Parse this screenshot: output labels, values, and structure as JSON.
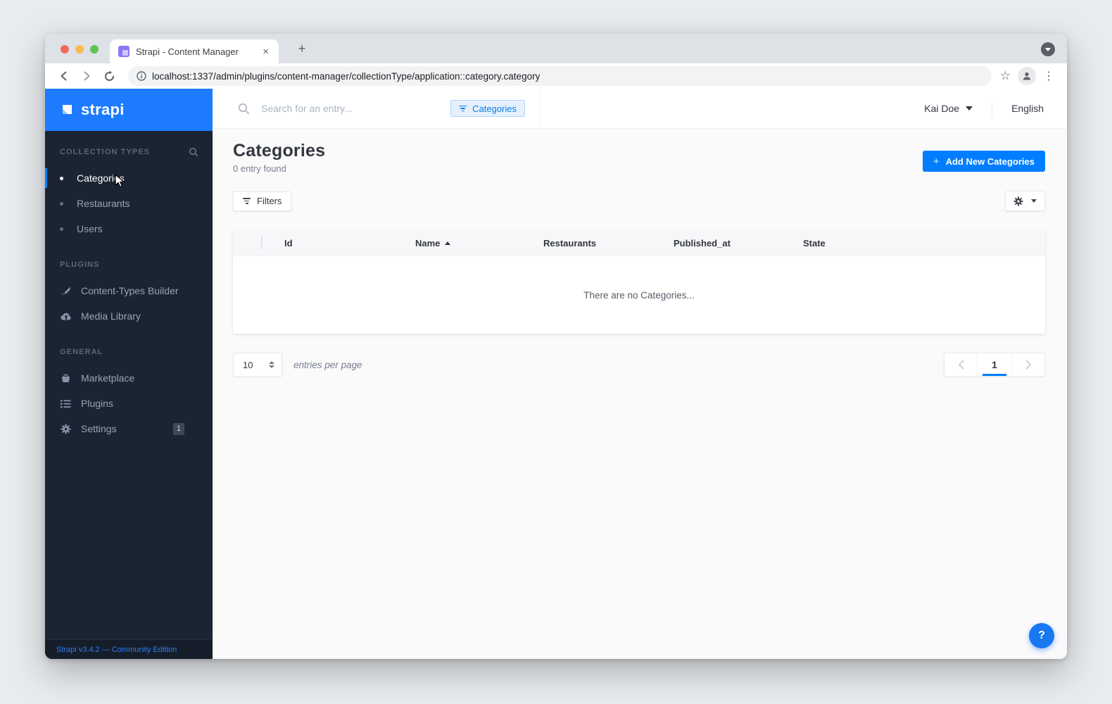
{
  "browser": {
    "tab_title": "Strapi - Content Manager",
    "url": "localhost:1337/admin/plugins/content-manager/collectionType/application::category.category"
  },
  "icons": {
    "plus": "+",
    "close": "×",
    "star": "☆",
    "menu_dots": "⋮",
    "question": "?"
  },
  "sidebar": {
    "logo_text": "strapi",
    "sections": [
      {
        "label": "COLLECTION TYPES",
        "items": [
          {
            "label": "Categories"
          },
          {
            "label": "Restaurants"
          },
          {
            "label": "Users"
          }
        ]
      },
      {
        "label": "PLUGINS",
        "items": [
          {
            "label": "Content-Types Builder"
          },
          {
            "label": "Media Library"
          }
        ]
      },
      {
        "label": "GENERAL",
        "items": [
          {
            "label": "Marketplace"
          },
          {
            "label": "Plugins"
          },
          {
            "label": "Settings",
            "badge": "1"
          }
        ]
      }
    ],
    "footer_link": "Strapi v3.4.2 — Community Edition"
  },
  "header": {
    "search_placeholder": "Search for an entry...",
    "content_type_chip": "Categories",
    "user_name": "Kai Doe",
    "language": "English"
  },
  "content": {
    "title": "Categories",
    "entries_found": "0 entry found",
    "add_button_label": "Add New Categories",
    "filters_button_label": "Filters",
    "table": {
      "columns": [
        "Id",
        "Name",
        "Restaurants",
        "Published_at",
        "State"
      ],
      "empty_message": "There are no Categories...",
      "rows": []
    },
    "pagination": {
      "page_size": "10",
      "page_size_label": "entries per page",
      "current_page": "1"
    }
  },
  "colors": {
    "primary_blue": "#007eff",
    "logo_header_blue": "#1c7bff",
    "sidebar_bg": "#1b2433",
    "main_bg": "#fafafb",
    "chip_bg": "#e6f0fd",
    "chip_border": "#abd3fa",
    "help_fab": "#1778f2",
    "favicon_purple": "#8c75f7"
  }
}
